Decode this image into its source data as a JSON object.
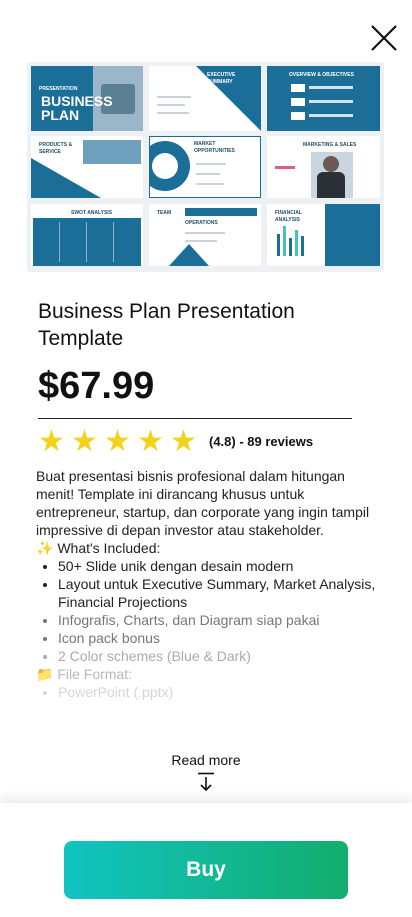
{
  "product": {
    "title": "Business Plan Presentation Template",
    "price": "$67.99",
    "rating": {
      "stars": 5,
      "text": "(4.8) - 89 reviews"
    },
    "preview": {
      "slide_labels": [
        "PRESENTATION",
        "BUSINESS",
        "PLAN",
        "EXECUTIVE SUMMARY",
        "OVERVIEW & OBJECTIVES",
        "PRODUCTS & SERVICE",
        "MARKET OPPORTUNITIES",
        "MARKETING & SALES",
        "SWOT ANALYSIS",
        "TEAM",
        "OPERATIONS",
        "FINANCIAL ANALYSIS"
      ]
    },
    "description": {
      "intro": "Buat presentasi bisnis profesional dalam hitungan menit! Template ini dirancang khusus untuk entrepreneur, startup, dan corporate yang ingin tampil impressive di depan investor atau stakeholder.",
      "included_heading": "✨ What's Included:",
      "included_items": [
        "50+ Slide unik dengan desain modern",
        "Layout untuk Executive Summary, Market Analysis, Financial Projections",
        "Infografis, Charts, dan Diagram siap pakai",
        "Icon pack bonus",
        "2 Color schemes (Blue & Dark)"
      ],
      "format_heading": "📁 File Format:",
      "format_items": [
        "PowerPoint (.pptx)"
      ]
    }
  },
  "actions": {
    "read_more": "Read more",
    "buy": "Buy"
  },
  "colors": {
    "star": "#f2d21b",
    "buy_gradient_start": "#11c4c2",
    "buy_gradient_end": "#13ad6d",
    "slide_blue": "#1b6e98"
  },
  "icons": [
    "close-icon",
    "star-icon",
    "arrow-down-icon"
  ]
}
